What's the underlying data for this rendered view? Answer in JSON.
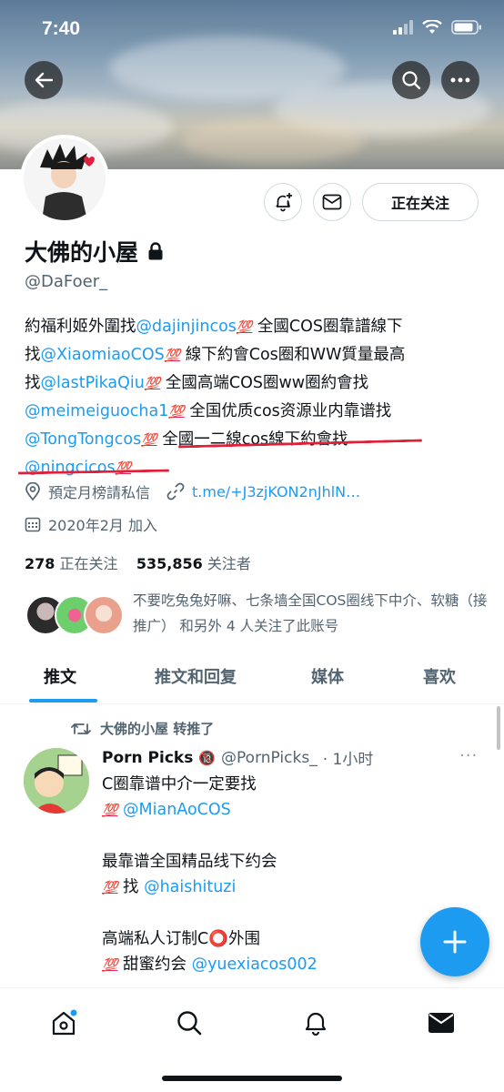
{
  "status_bar": {
    "time": "7:40"
  },
  "profile": {
    "name": "大佛的小屋",
    "handle": "@DaFoer_",
    "follow_button": "正在关注",
    "bio_lines": [
      {
        "text": "約福利姬外圍找",
        "mention": "@dajinjincos",
        "emoji": "💯",
        "tail": " 全國COS圈靠譜線下"
      },
      {
        "text": "找",
        "mention": "@XiaomiaoCOS",
        "emoji": "💯",
        "tail": " 線下約會Cos圈和WW質量最高"
      },
      {
        "text": "找",
        "mention": "@lastPikaQiu",
        "emoji": "💯",
        "tail": " 全國高端COS圈ww圈約會找"
      },
      {
        "text": "",
        "mention": "@meimeiguocha1",
        "emoji": "💯",
        "tail": " 全国优质cos资源业内靠谱找"
      },
      {
        "text": "",
        "mention": "@TongTongcos",
        "emoji": "💯",
        "tail": " 全國一二線cos線下約會找"
      },
      {
        "text": "",
        "mention": "@ningcicos",
        "emoji": "💯",
        "tail": ""
      }
    ],
    "location": "預定月榜請私信",
    "link": "t.me/+J3zjKON2nJhlN…",
    "joined": "2020年2月 加入",
    "following_count": "278",
    "following_label": "正在关注",
    "followers_count": "535,856",
    "followers_label": "关注者",
    "followed_by_text": "不要吃兔兔好嘛、七条墙全国COS圈线下中介、软糖（接推广） 和另外 4 人关注了此账号"
  },
  "tabs": [
    {
      "label": "推文",
      "active": true
    },
    {
      "label": "推文和回复",
      "active": false
    },
    {
      "label": "媒体",
      "active": false
    },
    {
      "label": "喜欢",
      "active": false
    }
  ],
  "tweet": {
    "retweet_label": "大佛的小屋 转推了",
    "author_name": "Porn Picks",
    "author_badge": "🔞",
    "author_handle": "@PornPicks_",
    "time": "· 1小时",
    "more": "···",
    "lines": [
      {
        "prefix": "C圈靠谱中介一定要找",
        "emoji": "",
        "mention": ""
      },
      {
        "prefix": "",
        "emoji": "💯",
        "mention": "@MianAoCOS"
      },
      {
        "prefix": "",
        "emoji": "",
        "mention": ""
      },
      {
        "prefix": "最靠谱全国精品线下约会",
        "emoji": "",
        "mention": ""
      },
      {
        "prefix": " 找 ",
        "emoji": "💯",
        "mention": "@haishituzi"
      },
      {
        "prefix": "",
        "emoji": "",
        "mention": ""
      },
      {
        "prefix": "高端私人订制C⭕外围",
        "emoji": "",
        "mention": ""
      },
      {
        "prefix": " 甜蜜约会 ",
        "emoji": "💯",
        "mention": "@yuexiacos002"
      }
    ]
  },
  "colors": {
    "accent": "#1d9bf0",
    "text": "#0f1419",
    "muted": "#536471",
    "annotation_red": "#e0203a"
  }
}
